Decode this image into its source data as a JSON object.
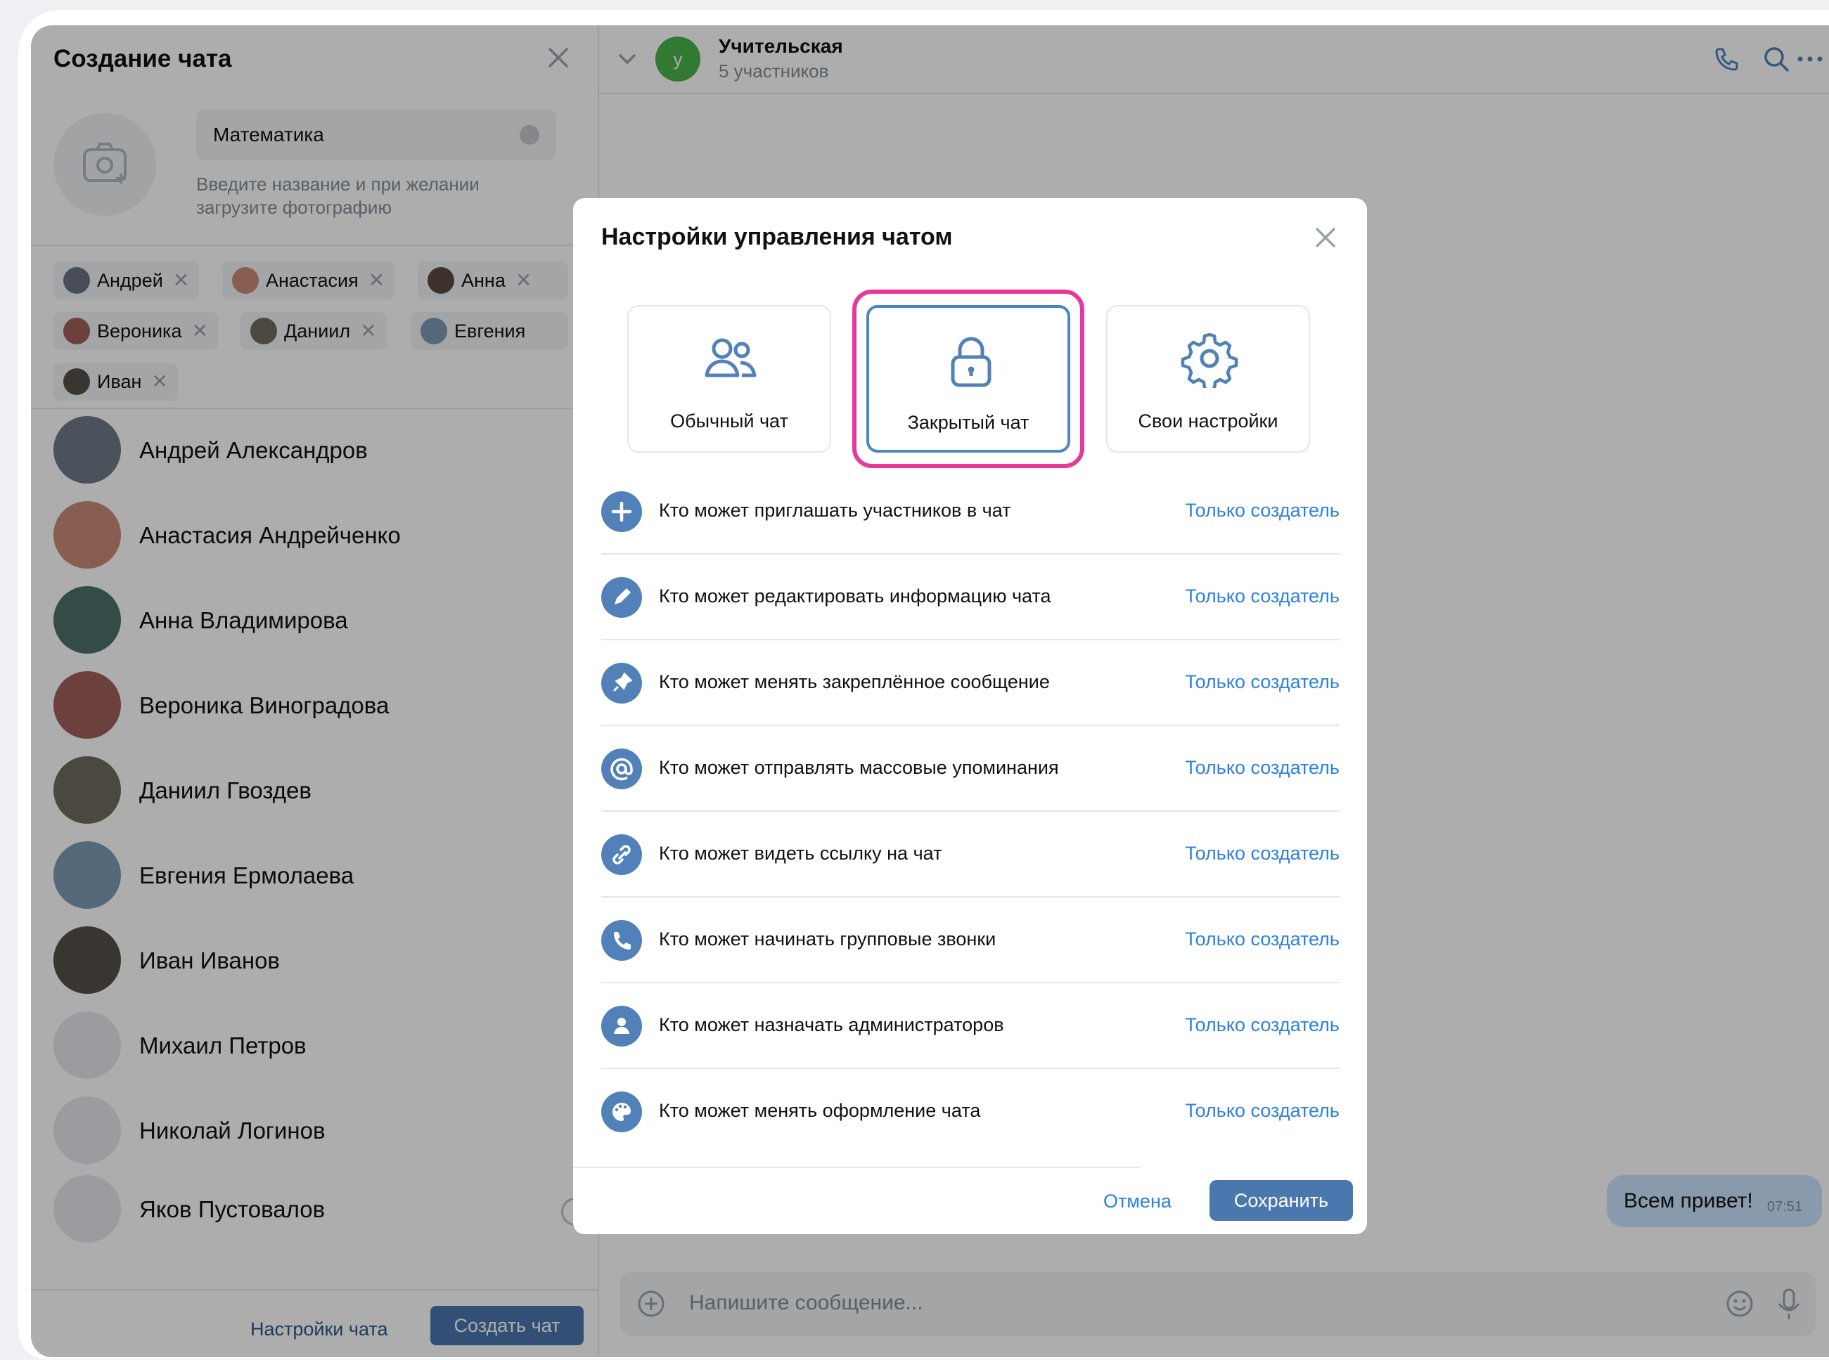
{
  "create_panel": {
    "title": "Создание чата",
    "name_value": "Математика",
    "name_hint": "Введите название и при желании загрузите фотографию",
    "chips": [
      "Андрей",
      "Анастасия",
      "Анна",
      "Вероника",
      "Даниил",
      "Евгения",
      "Иван"
    ],
    "contacts": [
      "Андрей Александров",
      "Анастасия Андрейченко",
      "Анна Владимирова",
      "Вероника Виноградова",
      "Даниил Гвоздев",
      "Евгения Ермолаева",
      "Иван Иванов",
      "Михаил Петров",
      "Николай Логинов",
      "Яков Пустовалов"
    ],
    "footer_settings": "Настройки чата",
    "footer_create": "Создать чат"
  },
  "chat": {
    "avatar_letter": "у",
    "title": "Учительская",
    "subtitle": "5 участников",
    "message_text": "Всем привет!",
    "message_time": "07:51",
    "composer_placeholder": "Напишите сообщение..."
  },
  "modal": {
    "title": "Настройки управления чатом",
    "presets": [
      "Обычный чат",
      "Закрытый чат",
      "Свои настройки"
    ],
    "selected_preset": "Закрытый чат",
    "settings": [
      {
        "label": "Кто может приглашать участников в чат",
        "value": "Только создатель",
        "icon": "plus-icon"
      },
      {
        "label": "Кто может редактировать информацию чата",
        "value": "Только создатель",
        "icon": "pencil-icon"
      },
      {
        "label": "Кто может менять закреплённое сообщение",
        "value": "Только создатель",
        "icon": "pin-icon"
      },
      {
        "label": "Кто может отправлять массовые упоминания",
        "value": "Только создатель",
        "icon": "at-icon"
      },
      {
        "label": "Кто может видеть ссылку на чат",
        "value": "Только создатель",
        "icon": "link-icon"
      },
      {
        "label": "Кто может начинать групповые звонки",
        "value": "Только создатель",
        "icon": "phone-icon"
      },
      {
        "label": "Кто может назначать администраторов",
        "value": "Только создатель",
        "icon": "user-icon"
      },
      {
        "label": "Кто может менять оформление чата",
        "value": "Только создатель",
        "icon": "palette-icon"
      }
    ],
    "cancel_label": "Отмена",
    "save_label": "Сохранить"
  },
  "colors": {
    "accent": "#4a77ad",
    "link": "#2d81e0",
    "highlight": "#e6399b",
    "chat_avatar": "#4bb34b"
  }
}
